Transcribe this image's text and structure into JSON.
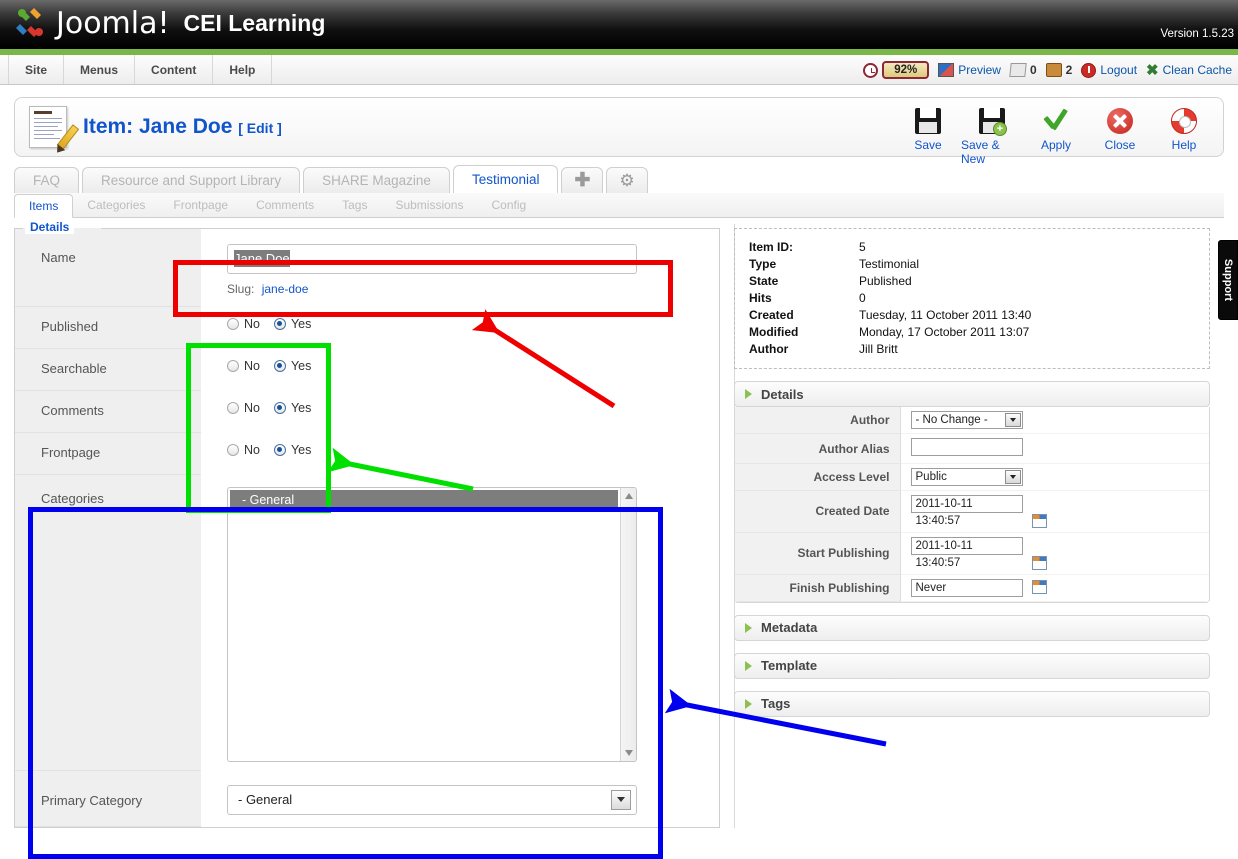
{
  "header": {
    "brand": "Joomla!",
    "site_name": "CEI Learning",
    "version": "Version 1.5.23"
  },
  "menu": {
    "items": [
      {
        "label": "Site"
      },
      {
        "label": "Menus"
      },
      {
        "label": "Content"
      },
      {
        "label": "Help"
      }
    ],
    "status": {
      "percent": "92%",
      "preview_label": "Preview",
      "messages_count": "0",
      "users_count": "2",
      "logout_label": "Logout",
      "clean_cache_label": "Clean Cache"
    }
  },
  "page": {
    "title": "Item: Jane Doe",
    "title_suffix": "[ Edit ]"
  },
  "toolbar": {
    "buttons": [
      {
        "label": "Save",
        "icon": "save-icon"
      },
      {
        "label": "Save & New",
        "icon": "save-new-icon"
      },
      {
        "label": "Apply",
        "icon": "apply-check-icon"
      },
      {
        "label": "Close",
        "icon": "close-x-icon"
      },
      {
        "label": "Help",
        "icon": "help-lifebuoy-icon"
      }
    ]
  },
  "tabs": {
    "items": [
      {
        "label": "FAQ",
        "active": false
      },
      {
        "label": "Resource and Support Library",
        "active": false
      },
      {
        "label": "SHARE Magazine",
        "active": false
      },
      {
        "label": "Testimonial",
        "active": true
      }
    ],
    "add_icon": "plus-icon",
    "settings_icon": "gear-icon"
  },
  "subtabs": {
    "items": [
      {
        "label": "Items",
        "active": true
      },
      {
        "label": "Categories",
        "active": false
      },
      {
        "label": "Frontpage",
        "active": false
      },
      {
        "label": "Comments",
        "active": false
      },
      {
        "label": "Tags",
        "active": false
      },
      {
        "label": "Submissions",
        "active": false
      },
      {
        "label": "Config",
        "active": false
      }
    ]
  },
  "details_form": {
    "legend": "Details",
    "name_label": "Name",
    "name_value": "Jane Doe",
    "slug_label": "Slug:",
    "slug_value": "jane-doe",
    "radio_no": "No",
    "radio_yes": "Yes",
    "rows": [
      {
        "label": "Published",
        "value": "Yes"
      },
      {
        "label": "Searchable",
        "value": "Yes"
      },
      {
        "label": "Comments",
        "value": "Yes"
      },
      {
        "label": "Frontpage",
        "value": "Yes"
      }
    ],
    "categories_label": "Categories",
    "categories_options": [
      "- General"
    ],
    "categories_selected": "- General",
    "primary_category_label": "Primary Category",
    "primary_category_value": "- General"
  },
  "info": {
    "rows": [
      {
        "key": "Item ID:",
        "value": "5"
      },
      {
        "key": "Type",
        "value": "Testimonial"
      },
      {
        "key": "State",
        "value": "Published"
      },
      {
        "key": "Hits",
        "value": "0"
      },
      {
        "key": "Created",
        "value": "Tuesday, 11 October 2011 13:40"
      },
      {
        "key": "Modified",
        "value": "Monday, 17 October 2011 13:07"
      },
      {
        "key": "Author",
        "value": "Jill Britt"
      }
    ]
  },
  "side_panels": {
    "details": {
      "title": "Details",
      "author_label": "Author",
      "author_value": "- No Change -",
      "author_alias_label": "Author Alias",
      "author_alias_value": "",
      "access_level_label": "Access Level",
      "access_level_value": "Public",
      "created_date_label": "Created Date",
      "created_date_value": "2011-10-11 13:40:57",
      "start_publishing_label": "Start Publishing",
      "start_publishing_value": "2011-10-11 13:40:57",
      "finish_publishing_label": "Finish Publishing",
      "finish_publishing_value": "Never"
    },
    "collapsed": [
      {
        "title": "Metadata"
      },
      {
        "title": "Template"
      },
      {
        "title": "Tags"
      }
    ]
  },
  "support_tab": {
    "label": "Support"
  },
  "annotations": {
    "red": {
      "color": "#ee0000"
    },
    "green": {
      "color": "#00e000"
    },
    "blue": {
      "color": "#0000ee"
    }
  }
}
